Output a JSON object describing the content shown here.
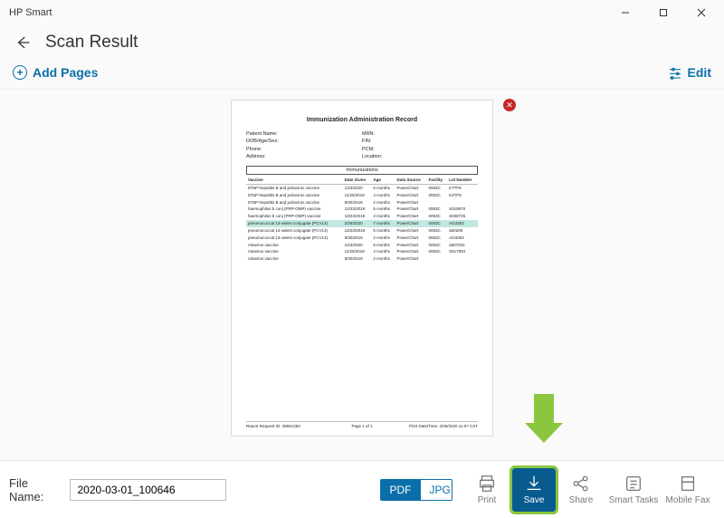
{
  "window": {
    "app_title": "HP Smart"
  },
  "header": {
    "title": "Scan Result"
  },
  "toolbar": {
    "add_pages": "Add Pages",
    "edit": "Edit"
  },
  "preview": {
    "doc_title": "Immunization Administration Record",
    "meta_left": [
      "Patient Name:",
      "DOB/Age/Sex:",
      "Phone:",
      "Address:"
    ],
    "meta_right": [
      "MRN:",
      "FIN:",
      "PCM:",
      "Location:"
    ],
    "section_label": "Immunizations",
    "columns": [
      "Vaccine",
      "Date Given",
      "Age",
      "Data Source",
      "Facility",
      "Lot Number"
    ],
    "rows": [
      {
        "v": "DTaP-hepatitis B and poliovirus vaccine",
        "d": "1/23/2020",
        "a": "6 months",
        "s": "PowerChart",
        "f": "0053C",
        "l": "K7TF9"
      },
      {
        "v": "DTaP-hepatitis B and poliovirus vaccine",
        "d": "11/25/2019",
        "a": "4 months",
        "s": "PowerChart",
        "f": "0053C",
        "l": "K2TF9"
      },
      {
        "v": "DTaP-hepatitis B and poliovirus vaccine",
        "d": "9/30/2019",
        "a": "2 months",
        "s": "PowerChart",
        "f": "",
        "l": ""
      },
      {
        "v": "haemophilus b conj (PRP-OMP) vaccine",
        "d": "12/23/2019",
        "a": "5 months",
        "s": "PowerChart",
        "f": "0053C",
        "l": "S019870"
      },
      {
        "v": "haemophilus b conj (PRP-OMP) vaccine",
        "d": "10/23/2019",
        "a": "3 months",
        "s": "PowerChart",
        "f": "0053C",
        "l": "S038726"
      },
      {
        "v": "pneumococcal 13-valent conjugate (PCV13)",
        "d": "2/26/2020",
        "a": "7 months",
        "s": "PowerChart",
        "f": "0053C",
        "l": "AG3353",
        "hl": true
      },
      {
        "v": "pneumococcal 13-valent conjugate (PCV13)",
        "d": "12/23/2019",
        "a": "5 months",
        "s": "PowerChart",
        "f": "0053C",
        "l": "a60209"
      },
      {
        "v": "pneumococcal 13-valent conjugate (PCV13)",
        "d": "9/30/2019",
        "a": "2 months",
        "s": "PowerChart",
        "f": "0053C",
        "l": "AG3353"
      },
      {
        "v": "rotavirus vaccine",
        "d": "1/23/2020",
        "a": "6 months",
        "s": "PowerChart",
        "f": "0053C",
        "l": "a507031"
      },
      {
        "v": "rotavirus vaccine",
        "d": "11/25/2019",
        "a": "4 months",
        "s": "PowerChart",
        "f": "0053C",
        "l": "S517804"
      },
      {
        "v": "rotavirus vaccine",
        "d": "9/30/2019",
        "a": "2 months",
        "s": "PowerChart",
        "f": "",
        "l": ""
      }
    ],
    "footer": {
      "left": "Report Request ID:  38561360",
      "mid": "Page 1 of 1",
      "right": "Print Date/Time:  2/26/2020 11:07 CST"
    }
  },
  "bottom": {
    "filename_label": "File Name:",
    "filename_value": "2020-03-01_100646",
    "format_pdf": "PDF",
    "format_jpg": "JPG",
    "actions": {
      "print": "Print",
      "save": "Save",
      "share": "Share",
      "smart_tasks": "Smart Tasks",
      "mobile_fax": "Mobile Fax"
    }
  }
}
